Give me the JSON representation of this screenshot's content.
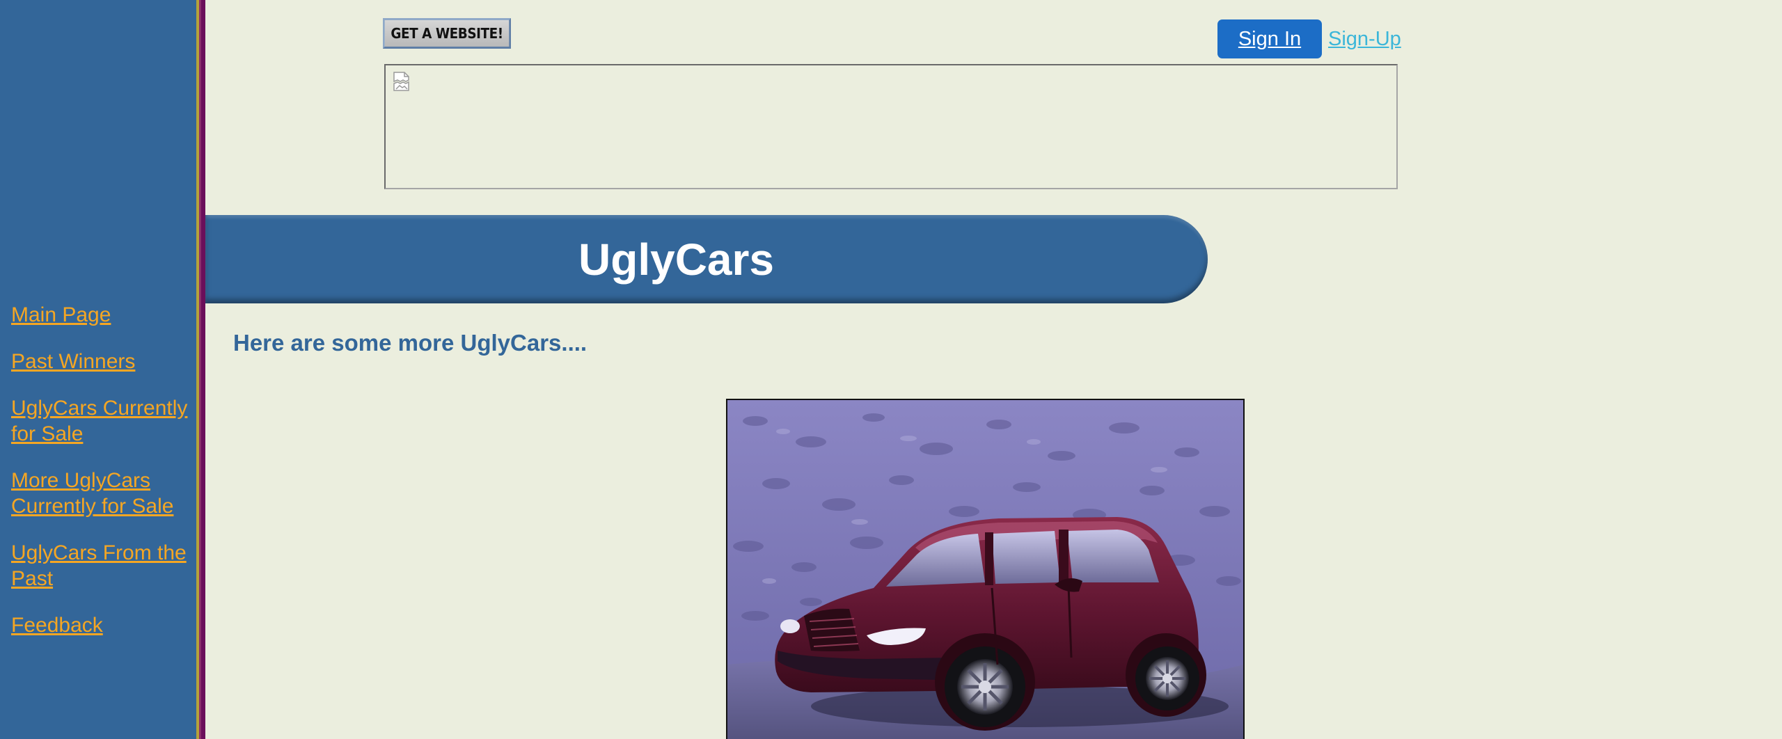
{
  "colors": {
    "page_background": "#ebeede",
    "sidebar": "#336699",
    "nav_link": "#f5a623",
    "banner": "#336699",
    "subheading": "#336699",
    "signin_button": "#1c6dc6",
    "signup_link": "#3bb6d9"
  },
  "header": {
    "get_website_label": "GET A WEBSITE!",
    "signin_label": "Sign In",
    "signup_label": "Sign-Up",
    "ad_icon": "broken-image-icon"
  },
  "sidebar": {
    "items": [
      {
        "label": "Main Page"
      },
      {
        "label": "Past Winners"
      },
      {
        "label": "UglyCars Currently for Sale"
      },
      {
        "label": "More UglyCars Currently for Sale"
      },
      {
        "label": "UglyCars From the Past"
      },
      {
        "label": "Feedback"
      }
    ]
  },
  "main": {
    "banner_title": "UglyCars",
    "subheading": "Here are some more UglyCars...."
  }
}
